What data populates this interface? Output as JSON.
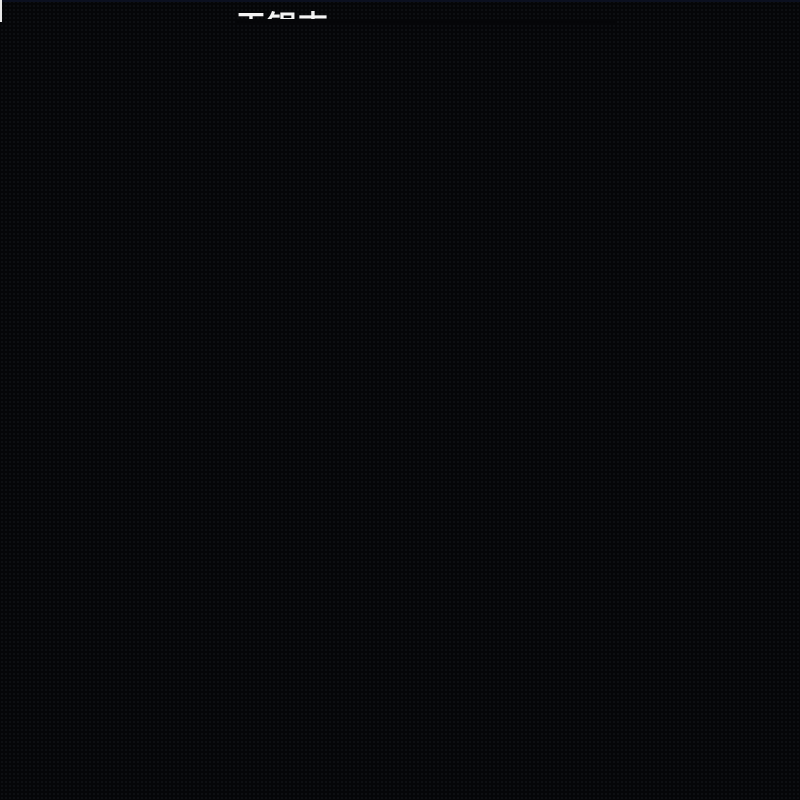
{
  "screen": {
    "title": "王银吉",
    "background_color": "#050608",
    "text_color": "#f4f4f4"
  }
}
